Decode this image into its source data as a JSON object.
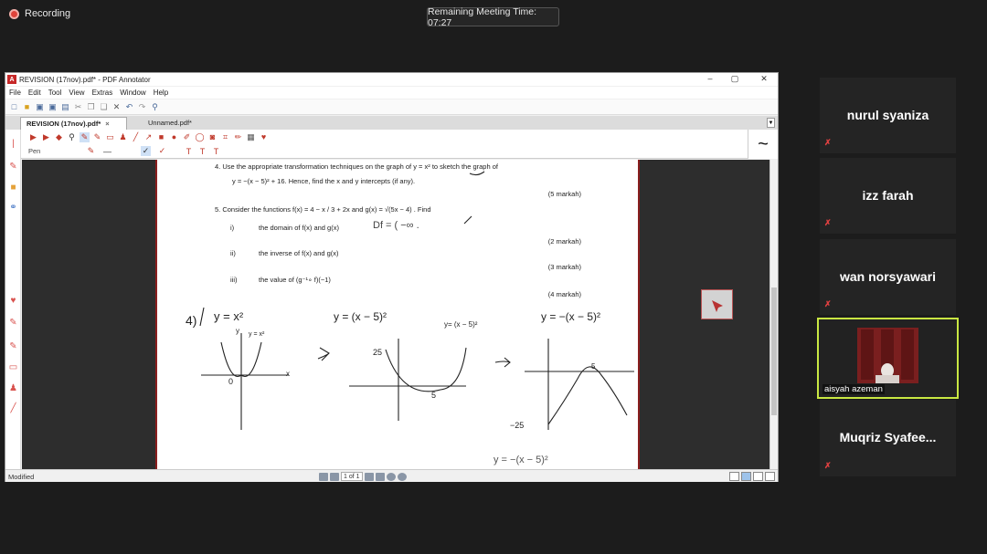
{
  "recording": {
    "label": "Recording"
  },
  "meeting": {
    "remaining": "Remaining Meeting Time: 07:27"
  },
  "window": {
    "title": "REVISION (17nov).pdf* - PDF Annotator",
    "minimize": "–",
    "maximize": "▢",
    "close": "✕"
  },
  "menu": [
    "File",
    "Edit",
    "Tool",
    "View",
    "Extras",
    "Window",
    "Help"
  ],
  "tabs": [
    {
      "label": "REVISION (17nov).pdf*"
    },
    {
      "label": "Unnamed.pdf*"
    }
  ],
  "toolbar3": {
    "pen_label": "Pen"
  },
  "document": {
    "q4": "4.   Use the appropriate transformation techniques on the graph of  y = x²  to sketch the graph of",
    "q4b": "y = −(x − 5)² + 16. Hence, find the x and y intercepts (if any).",
    "q4_mark": "(5 markah)",
    "q5": "5.   Consider the functions  f(x) =  4 − x / 3 + 2x  and  g(x) = √(5x − 4) .  Find",
    "q5i_num": "i)",
    "q5i": "the domain of  f(x)  and  g(x)",
    "q5i_mark": "(2 markah)",
    "q5ii_num": "ii)",
    "q5ii": "the inverse of  f(x)  and  g(x)",
    "q5ii_mark": "(3 markah)",
    "q5iii_num": "iii)",
    "q5iii": "the value of  (g⁻¹∘ f)(−1)",
    "q5iii_mark": "(4 markah)",
    "hand": {
      "label4": "4)",
      "eq1": "y = x²",
      "eq1b": "y = x²",
      "eq2": "y = (x − 5)²",
      "eq2b": "y= (x − 5)²",
      "eq3": "y = −(x − 5)²",
      "lbl_25": "25",
      "lbl_5a": "5",
      "lbl_5b": "5",
      "lbl_0": "0",
      "lbl_x": "x",
      "lbl_y": "y",
      "lbl_n25": "−25",
      "bottom": "y = −(x − 5)²",
      "domain": "Df = ( −∞ ."
    }
  },
  "status": {
    "modified": "Modified",
    "page": "1 of 1"
  },
  "participants": [
    {
      "name": "nurul syaniza"
    },
    {
      "name": "izz farah"
    },
    {
      "name": "wan norsyawari"
    },
    {
      "name": "aisyah azeman"
    },
    {
      "name": "Muqriz  Syafee..."
    }
  ]
}
